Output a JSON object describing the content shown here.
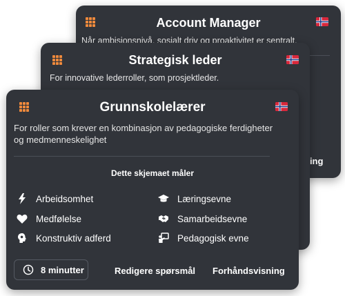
{
  "colors": {
    "card_bg": "#31343a",
    "accent_orange": "#f08a3c",
    "divider": "#4b4f57"
  },
  "cards": {
    "back": {
      "title": "Account Manager",
      "description": "Når ambisjonsnivå, sosialt driv og proaktivitet er sentralt.",
      "partial_action": "ning"
    },
    "mid": {
      "title": "Strategisk leder",
      "description": "For innovative lederroller, som prosjektleder."
    },
    "front": {
      "title": "Grunnskolelærer",
      "description": "For roller som krever en kombinasjon av pedagogiske ferdigheter og medmenneskelighet",
      "section_title": "Dette skjemaet måler",
      "traits_left": [
        {
          "icon": "lightning-icon",
          "label": "Arbeidsomhet"
        },
        {
          "icon": "heart-icon",
          "label": "Medfølelse"
        },
        {
          "icon": "brain-icon",
          "label": "Konstruktiv adferd"
        }
      ],
      "traits_right": [
        {
          "icon": "graduation-cap-icon",
          "label": "Læringsevne"
        },
        {
          "icon": "handshake-icon",
          "label": "Samarbeidsevne"
        },
        {
          "icon": "teacher-board-icon",
          "label": "Pedagogisk evne"
        }
      ],
      "duration": "8 minutter",
      "edit_label": "Redigere spørsmål",
      "preview_label": "Forhåndsvisning"
    }
  }
}
